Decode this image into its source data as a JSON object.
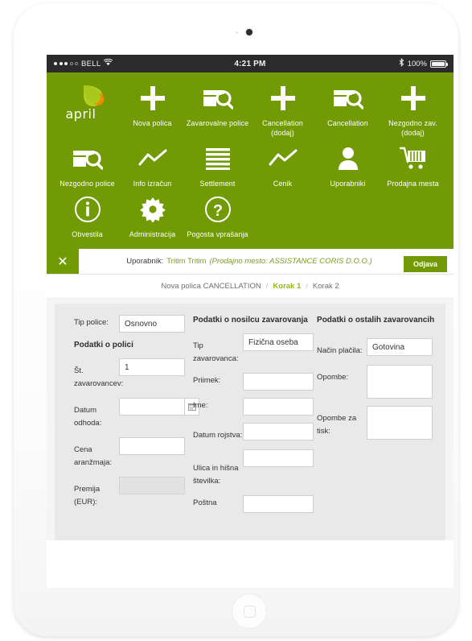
{
  "statusbar": {
    "carrier": "BELL",
    "signal_dots_filled": 3,
    "signal_dots_total": 5,
    "wifi_icon": "wifi-icon",
    "time": "4:21 PM",
    "bluetooth_icon": "bluetooth-icon",
    "battery_percent": "100%"
  },
  "nav": {
    "background_color": "#719a05",
    "brand": "april",
    "rows": [
      [
        {
          "label": "",
          "icon": "april-logo",
          "is_logo": true
        },
        {
          "label": "Nova polica",
          "icon": "plus-icon"
        },
        {
          "label": "Zavarovalne police",
          "icon": "card-search-icon"
        },
        {
          "label": "Cancellation (dodaj)",
          "icon": "plus-icon"
        },
        {
          "label": "Cancellation",
          "icon": "card-search-icon"
        },
        {
          "label": "Nezgodno zav. (dodaj)",
          "icon": "plus-icon"
        }
      ],
      [
        {
          "label": "Nezgodno police",
          "icon": "card-search-icon"
        },
        {
          "label": "Info izračun",
          "icon": "line-chart-icon"
        },
        {
          "label": "Settlement",
          "icon": "list-lines-icon"
        },
        {
          "label": "Cenik",
          "icon": "line-chart-icon"
        },
        {
          "label": "Uporabniki",
          "icon": "user-icon"
        },
        {
          "label": "Prodajna mesta",
          "icon": "shopping-cart-icon"
        }
      ],
      [
        {
          "label": "Obvestila",
          "icon": "info-circle-icon"
        },
        {
          "label": "Administracija",
          "icon": "gear-icon"
        },
        {
          "label": "Pogosta vprašanja",
          "icon": "question-circle-icon"
        }
      ]
    ]
  },
  "userbar": {
    "close_icon": "close-icon",
    "user_prefix": "Uporabnik:",
    "user_name": "Tritim Tritim",
    "sales_point": "(Prodajno mesto: ASSISTANCE CORIS D.O.O.)",
    "logout_label": "Odjava",
    "accent_color": "#719a05"
  },
  "breadcrumb": {
    "root": "Nova polica CANCELLATION",
    "separator": "/",
    "step1": "Korak 1",
    "step2": "Korak 2",
    "active_color": "#95b80f"
  },
  "form": {
    "col1": {
      "tip_police_label": "Tip police:",
      "tip_police_value": "Osnovno",
      "section_title": "Podatki o polici",
      "st_zavarovancev_label": "Št. zavarovancev:",
      "st_zavarovancev_value": "1",
      "datum_odhoda_label": "Datum odhoda:",
      "datum_odhoda_value": "",
      "calendar_icon": "calendar-icon",
      "cena_label": "Cena aranžmaja:",
      "cena_value": "",
      "premija_label": "Premija (EUR):",
      "premija_value": ""
    },
    "col2": {
      "section_title": "Podatki o nosilcu zavarovanja",
      "tip_zavarovanca_label": "Tip zavarovanca:",
      "tip_zavarovanca_value": "Fizična oseba",
      "priimek_label": "Priimek:",
      "priimek_value": "",
      "ime_label": "Ime:",
      "ime_value": "",
      "datum_rojstva_label": "Datum rojstva:",
      "datum_rojstva_value": "",
      "ulica_label": "Ulica in hišna številka:",
      "ulica_value": "",
      "postna_label": "Poštna",
      "postna_value": ""
    },
    "col3": {
      "section_title": "Podatki o ostalih zavarovancih",
      "nacin_placila_label": "Način plačila:",
      "nacin_placila_value": "Gotovina",
      "opombe_label": "Opombe:",
      "opombe_value": "",
      "opombe_tisk_label": "Opombe za tisk:",
      "opombe_tisk_value": ""
    }
  }
}
